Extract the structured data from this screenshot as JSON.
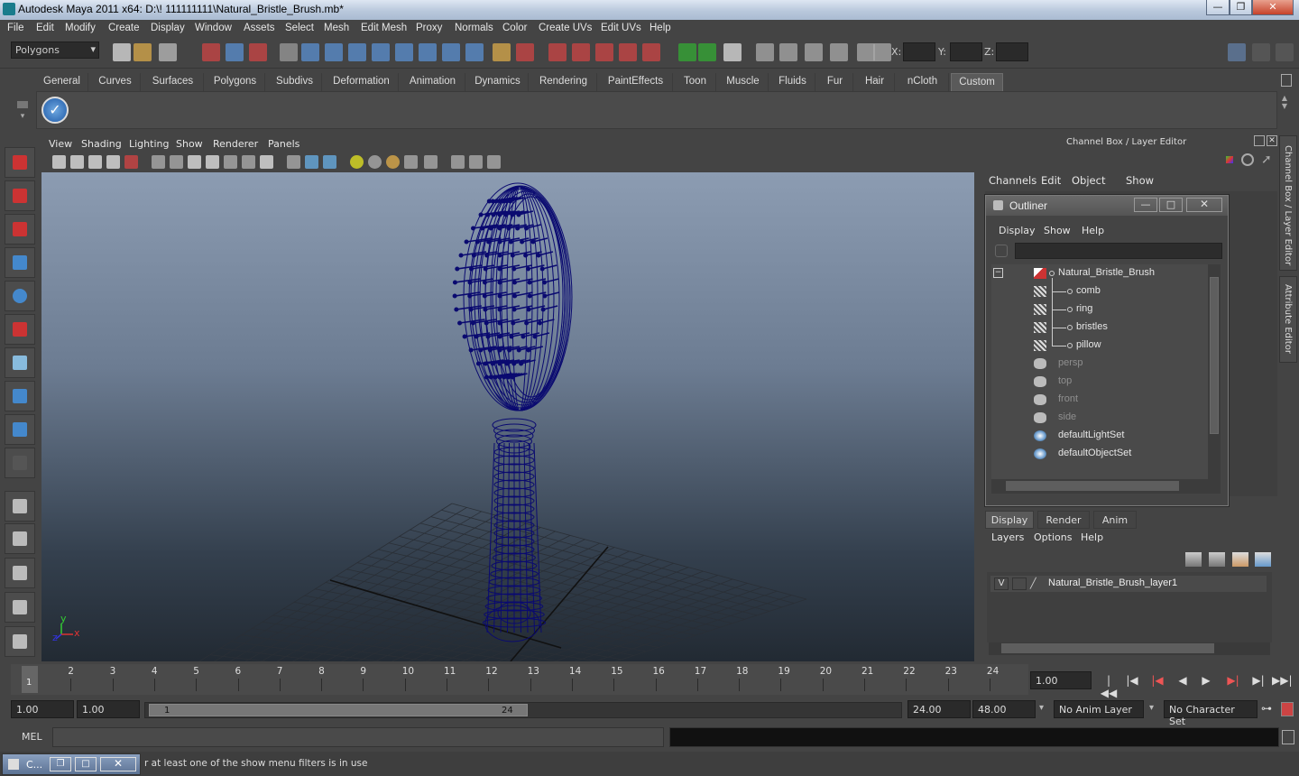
{
  "window": {
    "title": "Autodesk Maya 2011 x64: D:\\! 111111111\\Natural_Bristle_Brush.mb*",
    "minimize": "—",
    "restore": "❐",
    "close": "✕"
  },
  "menubar": [
    "File",
    "Edit",
    "Modify",
    "Create",
    "Display",
    "Window",
    "Assets",
    "Select",
    "Mesh",
    "Edit Mesh",
    "Proxy",
    "Normals",
    "Color",
    "Create UVs",
    "Edit UVs",
    "Help"
  ],
  "statusline": {
    "mode": "Polygons",
    "x_label": "X:",
    "y_label": "Y:",
    "z_label": "Z:"
  },
  "shelf": {
    "tabs": [
      "General",
      "Curves",
      "Surfaces",
      "Polygons",
      "Subdivs",
      "Deformation",
      "Animation",
      "Dynamics",
      "Rendering",
      "PaintEffects",
      "Toon",
      "Muscle",
      "Fluids",
      "Fur",
      "Hair",
      "nCloth",
      "Custom"
    ],
    "active_tab": "Custom"
  },
  "viewport": {
    "menus": [
      "View",
      "Shading",
      "Lighting",
      "Show",
      "Renderer",
      "Panels"
    ],
    "axis_y": "y",
    "axis_x": "x",
    "axis_z": "z",
    "bg_top": "#8c9cb2",
    "wire_color": "#0a0a70"
  },
  "channel_box": {
    "title": "Channel Box / Layer Editor",
    "menus": [
      "Channels",
      "Edit",
      "Object",
      "Show"
    ],
    "side_tab_1": "Channel Box / Layer Editor",
    "side_tab_2": "Attribute Editor"
  },
  "outliner": {
    "title": "Outliner",
    "menus": [
      "Display",
      "Show",
      "Help"
    ],
    "items": [
      {
        "label": "Natural_Bristle_Brush",
        "icon": "transform-icon",
        "level": 0,
        "dim": false
      },
      {
        "label": "comb",
        "icon": "mesh-icon",
        "level": 1,
        "dim": false
      },
      {
        "label": "ring",
        "icon": "mesh-icon",
        "level": 1,
        "dim": false
      },
      {
        "label": "bristles",
        "icon": "mesh-icon",
        "level": 1,
        "dim": false
      },
      {
        "label": "pillow",
        "icon": "mesh-icon",
        "level": 1,
        "dim": false
      },
      {
        "label": "persp",
        "icon": "camera-icon",
        "level": 0,
        "dim": true
      },
      {
        "label": "top",
        "icon": "camera-icon",
        "level": 0,
        "dim": true
      },
      {
        "label": "front",
        "icon": "camera-icon",
        "level": 0,
        "dim": true
      },
      {
        "label": "side",
        "icon": "camera-icon",
        "level": 0,
        "dim": true
      },
      {
        "label": "defaultLightSet",
        "icon": "set-icon",
        "level": 0,
        "dim": false
      },
      {
        "label": "defaultObjectSet",
        "icon": "set-icon",
        "level": 0,
        "dim": false
      }
    ]
  },
  "layer_editor": {
    "tabs": [
      "Display",
      "Render",
      "Anim"
    ],
    "active_tab": "Display",
    "menus": [
      "Layers",
      "Options",
      "Help"
    ],
    "layer_visibility": "V",
    "layer_name": "Natural_Bristle_Brush_layer1"
  },
  "timeline": {
    "ticks": [
      1,
      2,
      3,
      4,
      5,
      6,
      7,
      8,
      9,
      10,
      11,
      12,
      13,
      14,
      15,
      16,
      17,
      18,
      19,
      20,
      21,
      22,
      23,
      24
    ],
    "current_frame": "1",
    "current_time": "1.00"
  },
  "range": {
    "start": "1.00",
    "playback_start": "1.00",
    "slider_start": "1",
    "slider_end": "24",
    "playback_end": "24.00",
    "end": "48.00",
    "anim_layer": "No Anim Layer",
    "character_set": "No Character Set"
  },
  "command_line": {
    "label": "MEL"
  },
  "help_line": {
    "task_title": "C...",
    "text": "r at least one of the show menu filters is in use"
  }
}
